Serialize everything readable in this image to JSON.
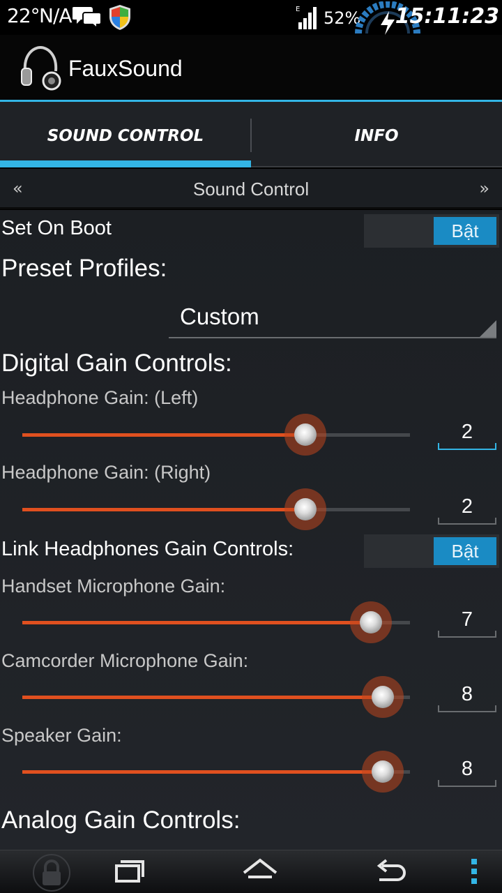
{
  "status_bar": {
    "temperature": "22°",
    "network": "N/A",
    "battery": "52%",
    "clock": "15:11:23",
    "icons": [
      "chat-bubbles-icon",
      "shield-icon",
      "signal-icon",
      "power-gauge-icon"
    ]
  },
  "app": {
    "title": "FauxSound",
    "logo_icon": "headphones-icon"
  },
  "tabs": [
    {
      "label": "SOUND CONTROL",
      "selected": true
    },
    {
      "label": "INFO",
      "selected": false
    }
  ],
  "pager": {
    "prev": "«",
    "title": "Sound Control",
    "next": "»"
  },
  "settings": {
    "set_on_boot": {
      "label": "Set On Boot",
      "toggle": "Bật"
    },
    "preset_profiles": {
      "label": "Preset Profiles:",
      "value": "Custom"
    },
    "digital_gain_heading": "Digital Gain Controls:",
    "headphone_left": {
      "label": "Headphone Gain: (Left)",
      "value": "2",
      "fraction": 0.73
    },
    "headphone_right": {
      "label": "Headphone Gain: (Right)",
      "value": "2",
      "fraction": 0.73
    },
    "link_headphones": {
      "label": "Link Headphones Gain Controls:",
      "toggle": "Bật"
    },
    "handset_mic": {
      "label": "Handset Microphone Gain:",
      "value": "7",
      "fraction": 0.9
    },
    "camcorder_mic": {
      "label": "Camcorder Microphone Gain:",
      "value": "8",
      "fraction": 0.93
    },
    "speaker": {
      "label": "Speaker Gain:",
      "value": "8",
      "fraction": 0.93
    },
    "analog_gain_heading": "Analog Gain Controls:"
  },
  "colors": {
    "accent": "#33b5e5",
    "slider_fill": "#e0501f",
    "toggle_on": "#1a8bc4"
  },
  "nav_bar": {
    "icons": [
      "lock-icon",
      "recent-apps-icon",
      "home-icon",
      "back-icon",
      "overflow-menu-icon"
    ]
  }
}
